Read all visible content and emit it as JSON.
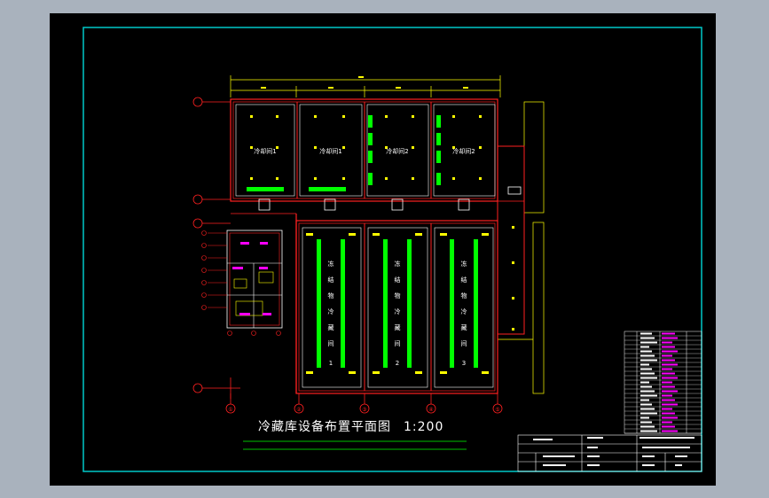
{
  "drawing": {
    "title": "冷藏库设备布置平面图",
    "scale": "1:200"
  },
  "room_labels": [
    "冷却间1",
    "冷却间1",
    "冷却间2",
    "冷却间2"
  ],
  "storage_text": [
    "冻",
    "结",
    "物",
    "冷",
    "藏",
    "间"
  ],
  "storage_numbers": [
    "1",
    "2",
    "3"
  ],
  "axis_bubbles_bottom": [
    "①",
    "②",
    "③",
    "④",
    "⑤"
  ],
  "colors": {
    "background": "#000000",
    "frame": "#00c8c8",
    "wall": "#ff2020",
    "dimension": "#ffff00",
    "coil": "#00ff00",
    "annotation": "#ffffff",
    "tag": "#ff00ff"
  }
}
